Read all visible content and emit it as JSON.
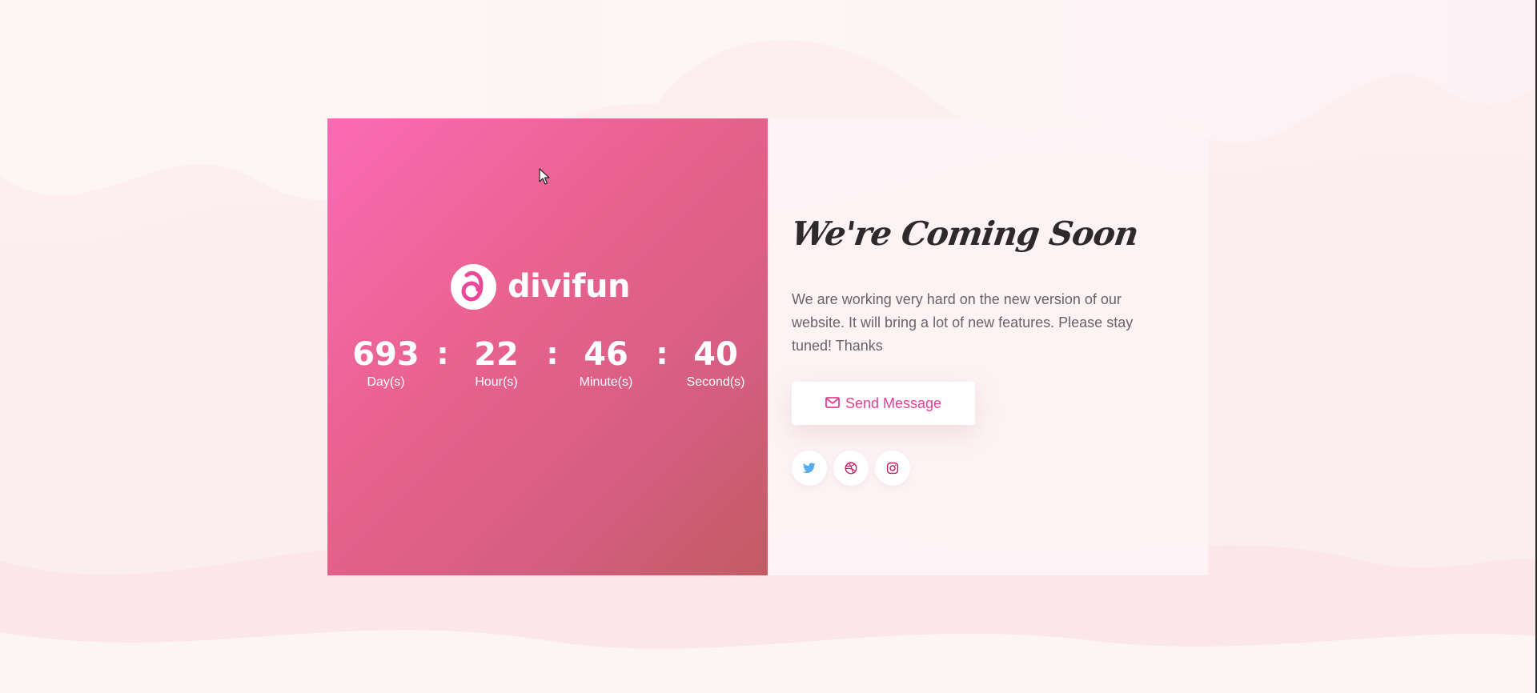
{
  "brand": {
    "name": "divifun",
    "logo_icon": "divifun-logo-icon",
    "color": "#ec4899"
  },
  "countdown": {
    "units": [
      {
        "value": "693",
        "label": "Day(s)"
      },
      {
        "value": "22",
        "label": "Hour(s)"
      },
      {
        "value": "46",
        "label": "Minute(s)"
      },
      {
        "value": "40",
        "label": "Second(s)"
      }
    ],
    "separator": ":"
  },
  "content": {
    "title": "We're Coming Soon",
    "description": "We are working very hard on the new version of our website. It will bring a  lot of new features. Please stay tuned! Thanks",
    "send_button": {
      "label": "Send Message",
      "icon": "envelope-icon"
    }
  },
  "socials": [
    {
      "name": "twitter",
      "icon": "twitter-icon",
      "color": "#55acee"
    },
    {
      "name": "dribbble",
      "icon": "dribbble-icon",
      "color": "#c2185b"
    },
    {
      "name": "instagram",
      "icon": "instagram-icon",
      "color": "#c2185b"
    }
  ],
  "colors": {
    "panel_gradient_start": "#fb6bb5",
    "panel_gradient_end": "#c35b63",
    "accent": "#e4408f",
    "text": "#6a6466",
    "title": "#2e2a2b"
  }
}
